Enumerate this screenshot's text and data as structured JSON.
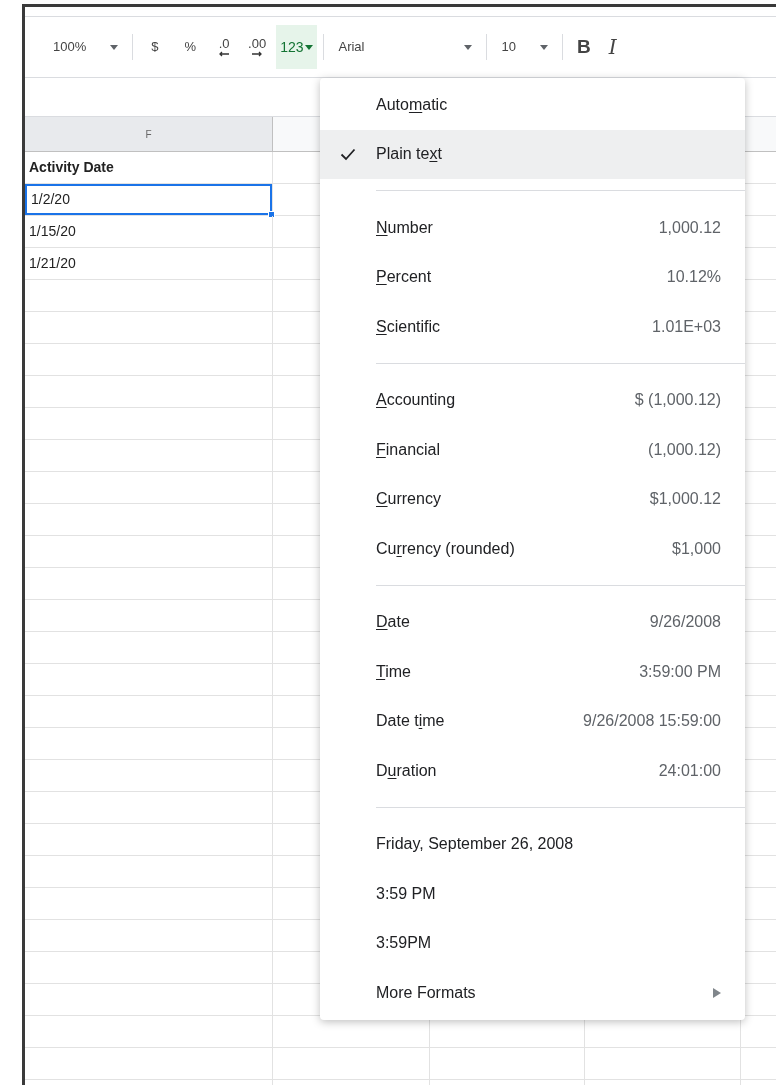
{
  "toolbar_groups": [
    [
      {
        "kind": "dropdown",
        "label": "100%",
        "selected": false
      }
    ],
    [
      {
        "kind": "button",
        "label": "$",
        "selected": false
      },
      {
        "kind": "button",
        "label": "%",
        "selected": false
      },
      {
        "kind": "decimal-decrease",
        "label": ".0",
        "selected": false
      },
      {
        "kind": "decimal-increase",
        "label": ".00",
        "selected": false
      },
      {
        "kind": "menu-button",
        "label": "123",
        "selected": true
      }
    ],
    [
      {
        "kind": "font-dropdown",
        "label": "Arial",
        "selected": false
      }
    ],
    [
      {
        "kind": "dropdown",
        "label": "10",
        "selected": false
      }
    ],
    [
      {
        "kind": "bold-button",
        "label": "B",
        "selected": false
      },
      {
        "kind": "italic-button",
        "label": "I",
        "selected": false
      }
    ]
  ],
  "sheet": {
    "column_header": "F",
    "cells": [
      {
        "text": "Activity Date",
        "bold": true,
        "selected": false
      },
      {
        "text": "1/2/20",
        "bold": false,
        "selected": true
      },
      {
        "text": "1/15/20",
        "bold": false,
        "selected": false
      },
      {
        "text": "1/21/20",
        "bold": false,
        "selected": false
      }
    ]
  },
  "format_menu": {
    "sections": [
      [
        {
          "kind": "format",
          "label_parts": {
            "lead": "Auto",
            "key": "m",
            "rest": "atic"
          },
          "checked": false,
          "selected": false
        },
        {
          "kind": "format",
          "label_parts": {
            "lead": "Plain te",
            "key": "x",
            "rest": "t"
          },
          "checked": true,
          "selected": true
        }
      ],
      [
        {
          "kind": "format",
          "label_parts": {
            "key": "N",
            "rest": "umber"
          },
          "example": "1,000.12",
          "checked": false,
          "selected": false
        },
        {
          "kind": "format",
          "label_parts": {
            "key": "P",
            "rest": "ercent"
          },
          "example": "10.12%",
          "checked": false,
          "selected": false
        },
        {
          "kind": "format",
          "label_parts": {
            "key": "S",
            "rest": "cientific"
          },
          "example": "1.01E+03",
          "checked": false,
          "selected": false
        }
      ],
      [
        {
          "kind": "format",
          "label_parts": {
            "key": "A",
            "rest": "ccounting"
          },
          "example": "$ (1,000.12)",
          "checked": false,
          "selected": false
        },
        {
          "kind": "format",
          "label_parts": {
            "key": "F",
            "rest": "inancial"
          },
          "example": "(1,000.12)",
          "checked": false,
          "selected": false
        },
        {
          "kind": "format",
          "label_parts": {
            "key": "C",
            "rest": "urrency"
          },
          "example": "$1,000.12",
          "checked": false,
          "selected": false
        },
        {
          "kind": "format",
          "label_parts": {
            "lead": "Cu",
            "key": "r",
            "rest": "rency (rounded)"
          },
          "example": "$1,000",
          "checked": false,
          "selected": false
        }
      ],
      [
        {
          "kind": "format",
          "label_parts": {
            "key": "D",
            "rest": "ate"
          },
          "example": "9/26/2008",
          "checked": false,
          "selected": false
        },
        {
          "kind": "format",
          "label_parts": {
            "key": "T",
            "rest": "ime"
          },
          "example": "3:59:00 PM",
          "checked": false,
          "selected": false
        },
        {
          "kind": "format",
          "label_parts": {
            "lead": "Date t",
            "key": "i",
            "rest": "me"
          },
          "example": "9/26/2008 15:59:00",
          "checked": false,
          "selected": false
        },
        {
          "kind": "format",
          "label_parts": {
            "lead": "D",
            "key": "u",
            "rest": "ration"
          },
          "example": "24:01:00",
          "checked": false,
          "selected": false
        }
      ],
      [
        {
          "kind": "format",
          "label": "Friday, September 26, 2008",
          "checked": false,
          "selected": false
        },
        {
          "kind": "format",
          "label": "3:59 PM",
          "checked": false,
          "selected": false
        },
        {
          "kind": "format",
          "label": "3:59PM",
          "checked": false,
          "selected": false
        },
        {
          "kind": "submenu",
          "label": "More Formats",
          "checked": false,
          "selected": false
        }
      ]
    ]
  }
}
